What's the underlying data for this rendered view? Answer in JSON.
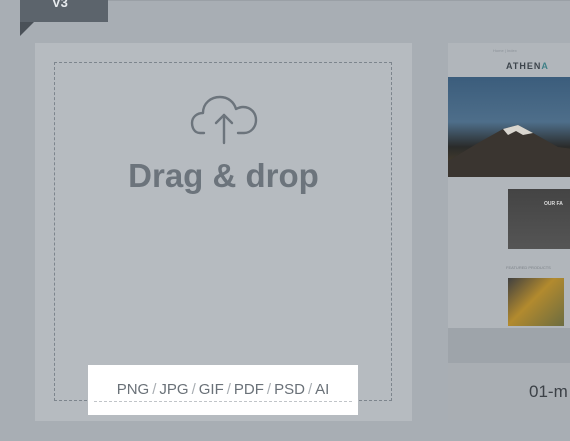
{
  "badge": {
    "label": "V3"
  },
  "dropzone": {
    "title": "Drag & drop",
    "formats": [
      "PNG",
      "JPG",
      "GIF",
      "PDF",
      "PSD",
      "AI"
    ],
    "separator": "/"
  },
  "template_card": {
    "mini_header": "Home  |  Index",
    "logo_main": "ATHEN",
    "logo_accent": "A",
    "feature_title": "OUR FA",
    "section_label": "FEATURED PRODUCTS",
    "name": "01-m"
  },
  "colors": {
    "overlay": "#a8aeb4",
    "badge": "#5c646c",
    "accent": "#3f8087"
  },
  "icons": [
    "cloud-upload-icon"
  ]
}
